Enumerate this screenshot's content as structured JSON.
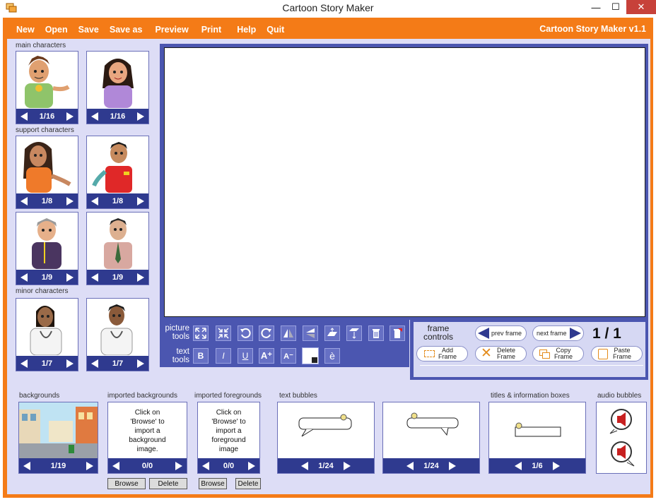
{
  "window": {
    "title": "Cartoon Story Maker",
    "min_glyph": "—",
    "max_glyph": "☐",
    "close_glyph": "✕"
  },
  "menu": {
    "items": [
      "New",
      "Open",
      "Save",
      "Save as",
      "Preview",
      "Print",
      "Help",
      "Quit"
    ],
    "version": "Cartoon Story Maker v1.1"
  },
  "sections": {
    "main": "main characters",
    "support": "support characters",
    "minor": "minor characters",
    "backgrounds": "backgrounds",
    "imported_backgrounds": "imported backgrounds",
    "imported_foregrounds": "imported foregrounds",
    "text_bubbles": "text bubbles",
    "titles": "titles & information boxes",
    "audio": "audio bubbles"
  },
  "characters": [
    {
      "counter": "1/16"
    },
    {
      "counter": "1/16"
    },
    {
      "counter": "1/8"
    },
    {
      "counter": "1/8"
    },
    {
      "counter": "1/9"
    },
    {
      "counter": "1/9"
    },
    {
      "counter": "1/7"
    },
    {
      "counter": "1/7"
    }
  ],
  "tools": {
    "picture_label": "picture\ntools",
    "text_label": "text\ntools",
    "bold": "B",
    "italic": "I",
    "underline": "U",
    "grow": "A⁺",
    "shrink": "A⁻",
    "accent": "è"
  },
  "frame": {
    "label": "frame\ncontrols",
    "prev": "prev frame",
    "next": "next frame",
    "counter": "1 / 1",
    "add": "Add\nFrame",
    "delete": "Delete\nFrame",
    "copy": "Copy\nFrame",
    "paste": "Paste\nFrame"
  },
  "bottom": {
    "backgrounds_counter": "1/19",
    "imported_bg_text": "Click on\n'Browse' to\nimport a\nbackground\nimage.",
    "imported_bg_counter": "0/0",
    "imported_fg_text": "Click on\n'Browse' to\nimport a\nforeground\nimage",
    "imported_fg_counter": "0/0",
    "browse": "Browse",
    "delete": "Delete",
    "bubble1_counter": "1/24",
    "bubble2_counter": "1/24",
    "titles_counter": "1/6"
  },
  "colors": {
    "orange": "#f47b17",
    "navy": "#2f3a8f",
    "panel": "#4b56b0",
    "workspace": "#ddddf6"
  }
}
